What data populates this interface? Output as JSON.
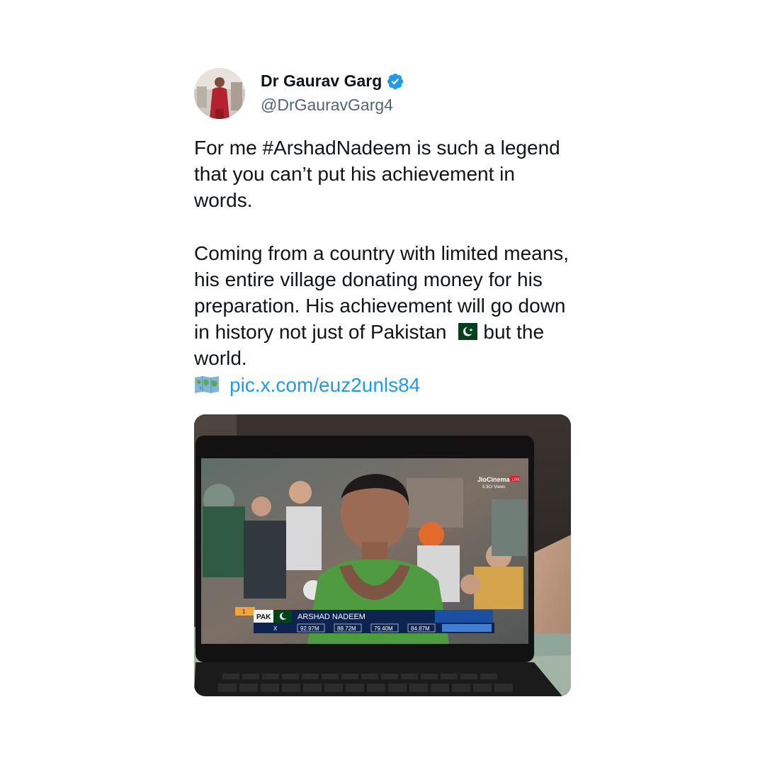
{
  "author": {
    "name": "Dr Gaurav Garg",
    "handle": "@DrGauravGarg4",
    "verified": true
  },
  "tweet": {
    "paragraph1": "For me #ArshadNadeem is such a legend that you can’t put his achievement in words.",
    "paragraph2_before_flag": "Coming from a country with limited means, his entire village donating money for his preparation. His achievement will go down in history not just of Pakistan",
    "paragraph2_after_flag": "but the world.",
    "link": "pic.x.com/euz2unls84"
  },
  "media": {
    "broadcaster": "JioCinema",
    "live_badge": "LIVE",
    "views": "5.3Cr Views",
    "rank": "1",
    "country": "PAK",
    "athlete_name": "ARSHAD NADEEM",
    "attempts": [
      "X",
      "92.97M",
      "88.72M",
      "79.40M",
      "84.87M"
    ]
  },
  "colors": {
    "link": "#1d9bf0",
    "verified": "#1d9bf0",
    "handle": "#536471",
    "text": "#0f1419"
  }
}
